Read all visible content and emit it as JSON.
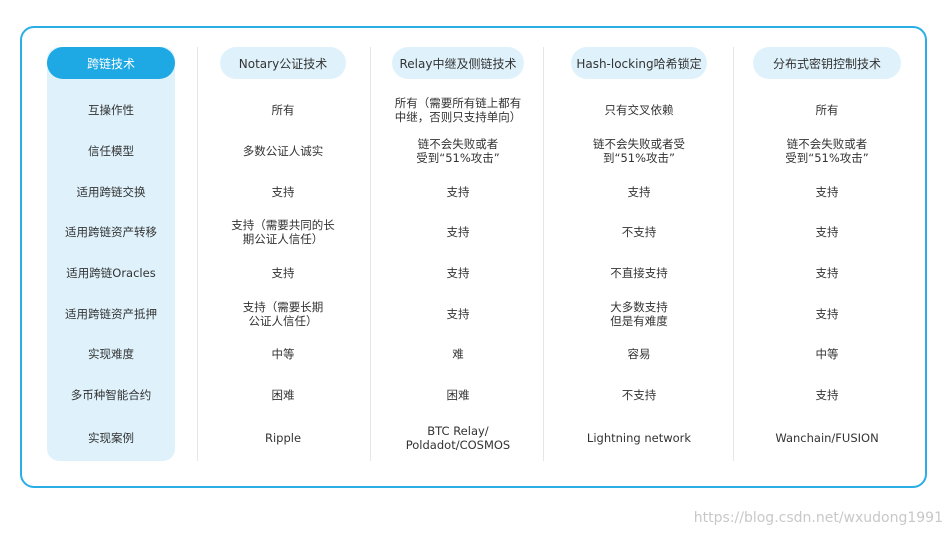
{
  "table": {
    "corner_header": "跨链技术",
    "columns": [
      "Notary公证技术",
      "Relay中继及侧链技术",
      "Hash-locking哈希锁定",
      "分布式密钥控制技术"
    ],
    "rows": [
      {
        "label": "互操作性",
        "cells": [
          "所有",
          "所有（需要所有链上都有\n中继，否则只支持单向）",
          "只有交叉依赖",
          "所有"
        ]
      },
      {
        "label": "信任模型",
        "cells": [
          "多数公证人诚实",
          "链不会失败或者\n受到“51%攻击”",
          "链不会失败或者受\n到“51%攻击”",
          "链不会失败或者\n受到“51%攻击”"
        ]
      },
      {
        "label": "适用跨链交换",
        "cells": [
          "支持",
          "支持",
          "支持",
          "支持"
        ]
      },
      {
        "label": "适用跨链资产转移",
        "cells": [
          "支持（需要共同的长\n期公证人信任）",
          "支持",
          "不支持",
          "支持"
        ]
      },
      {
        "label": "适用跨链Oracles",
        "cells": [
          "支持",
          "支持",
          "不直接支持",
          "支持"
        ]
      },
      {
        "label": "适用跨链资产抵押",
        "cells": [
          "支持（需要长期\n公证人信任）",
          "支持",
          "大多数支持\n但是有难度",
          "支持"
        ]
      },
      {
        "label": "实现难度",
        "cells": [
          "中等",
          "难",
          "容易",
          "中等"
        ]
      },
      {
        "label": "多币种智能合约",
        "cells": [
          "困难",
          "困难",
          "不支持",
          "支持"
        ]
      },
      {
        "label": "实现案例",
        "cells": [
          "Ripple",
          "BTC Relay/\nPoldadot/COSMOS",
          "Lightning network",
          "Wanchain/FUSION"
        ]
      }
    ]
  },
  "colors": {
    "border": "#29aee6",
    "header_pill": "#1ea8e4",
    "light_fill": "#dff2fb",
    "text": "#333333"
  },
  "watermark": "https://blog.csdn.net/wxudong1991"
}
